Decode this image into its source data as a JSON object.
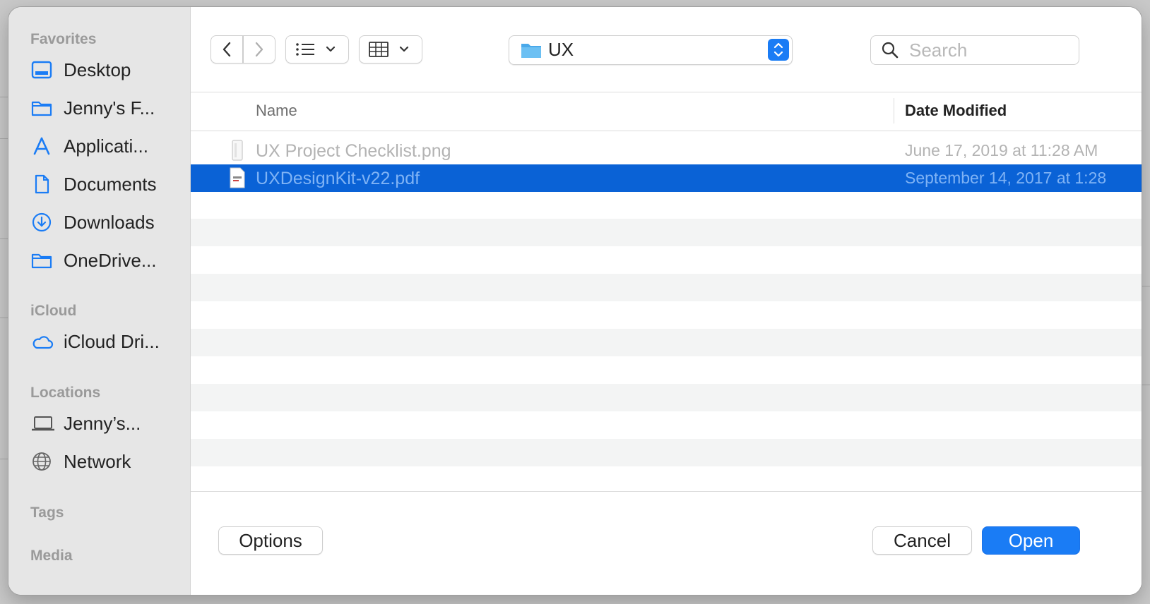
{
  "sidebar": {
    "sections": [
      {
        "title": "Favorites",
        "items": [
          {
            "label": "Desktop",
            "icon": "desktop-icon"
          },
          {
            "label": "Jenny's F...",
            "icon": "folder-icon"
          },
          {
            "label": "Applicati...",
            "icon": "applications-icon"
          },
          {
            "label": "Documents",
            "icon": "document-icon"
          },
          {
            "label": "Downloads",
            "icon": "downloads-icon"
          },
          {
            "label": "OneDrive...",
            "icon": "folder-icon"
          }
        ]
      },
      {
        "title": "iCloud",
        "items": [
          {
            "label": "iCloud Dri...",
            "icon": "cloud-icon"
          }
        ]
      },
      {
        "title": "Locations",
        "items": [
          {
            "label": "Jenny’s...",
            "icon": "laptop-icon"
          },
          {
            "label": "Network",
            "icon": "globe-icon"
          }
        ]
      },
      {
        "title": "Tags",
        "items": []
      },
      {
        "title": "Media",
        "items": []
      }
    ]
  },
  "toolbar": {
    "current_folder": "UX",
    "search_placeholder": "Search"
  },
  "table": {
    "columns": {
      "name": "Name",
      "date": "Date Modified"
    },
    "rows": [
      {
        "name": "UX Project Checklist.png",
        "date": "June 17, 2019 at 11:28 AM",
        "state": "disabled"
      },
      {
        "name": "UXDesignKit-v22.pdf",
        "date": "September 14, 2017 at 1:28",
        "state": "selected"
      }
    ]
  },
  "footer": {
    "options_label": "Options",
    "cancel_label": "Cancel",
    "open_label": "Open"
  },
  "colors": {
    "accent": "#1a7cf5",
    "selection": "#0a62d6",
    "sidebar_bg": "#e6e6e6"
  }
}
